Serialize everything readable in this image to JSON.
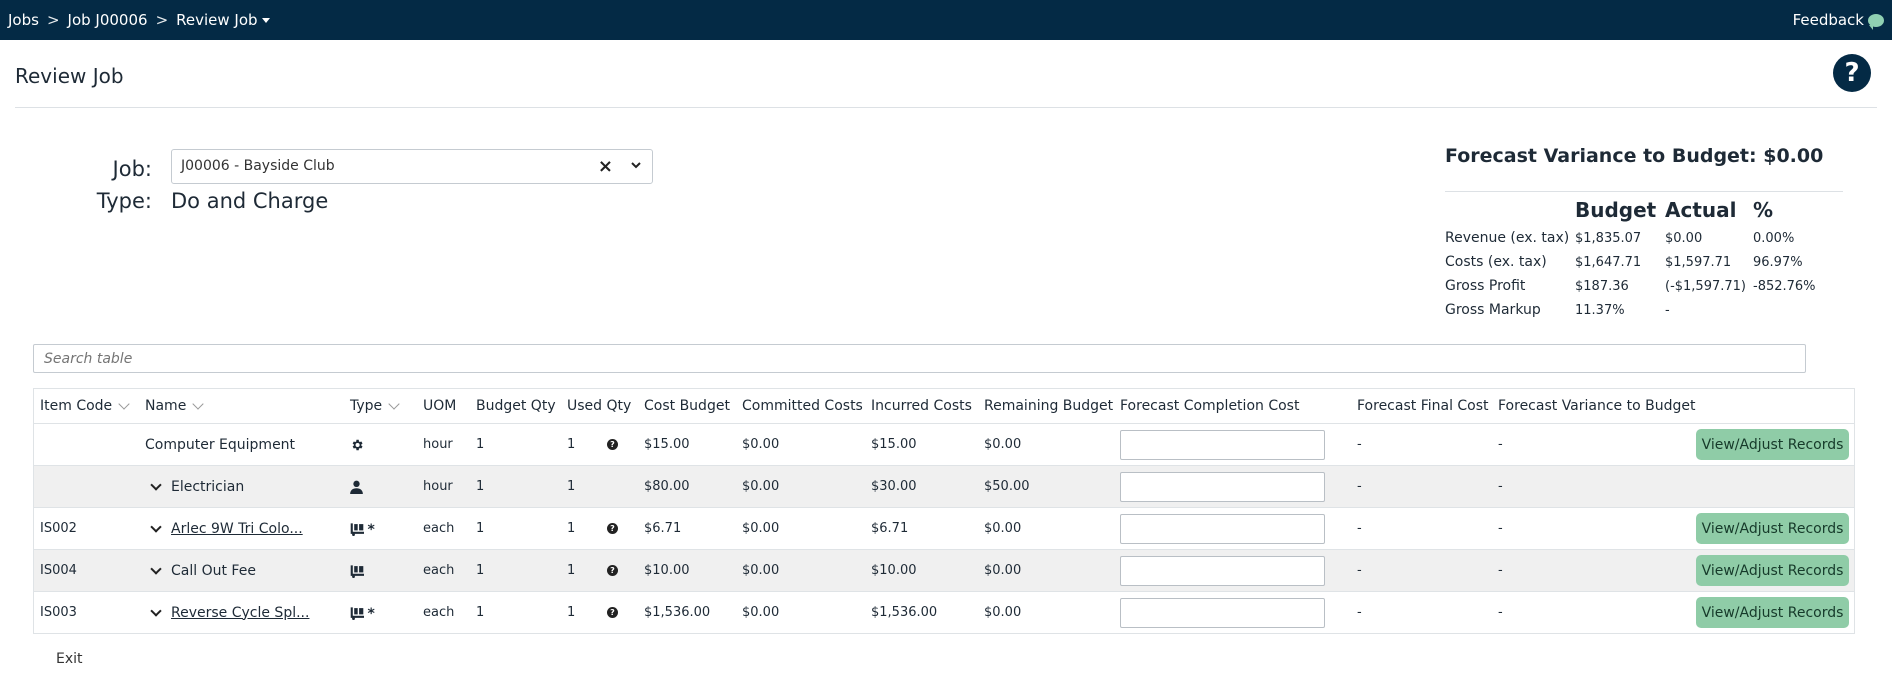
{
  "topbar": {
    "crumb_jobs": "Jobs",
    "crumb_sep": ">",
    "crumb_job": "Job J00006",
    "crumb_review": "Review Job",
    "feedback": "Feedback"
  },
  "page": {
    "title": "Review Job",
    "help": "?"
  },
  "form": {
    "job_label": "Job:",
    "job_value": "J00006 - Bayside Club",
    "type_label": "Type:",
    "type_value": "Do and Charge"
  },
  "summary": {
    "heading": "Forecast Variance to Budget: $0.00",
    "col_budget": "Budget",
    "col_actual": "Actual",
    "col_pct": "%",
    "rows": [
      {
        "label": "Revenue (ex. tax)",
        "budget": "$1,835.07",
        "actual": "$0.00",
        "pct": "0.00%"
      },
      {
        "label": "Costs (ex. tax)",
        "budget": "$1,647.71",
        "actual": "$1,597.71",
        "pct": "96.97%"
      },
      {
        "label": "Gross Profit",
        "budget": "$187.36",
        "actual": "(-$1,597.71)",
        "pct": "-852.76%"
      },
      {
        "label": "Gross Markup",
        "budget": "11.37%",
        "actual": "-",
        "pct": ""
      }
    ]
  },
  "search": {
    "placeholder": "Search table"
  },
  "table": {
    "headers": {
      "item_code": "Item Code",
      "name": "Name",
      "type": "Type",
      "uom": "UOM",
      "budget_qty": "Budget Qty",
      "used_qty": "Used Qty",
      "cost_budget": "Cost Budget",
      "committed": "Committed Costs",
      "incurred": "Incurred Costs",
      "remaining": "Remaining Budget",
      "fc_completion": "Forecast Completion Cost",
      "fc_final": "Forecast Final Cost",
      "fc_variance": "Forecast Variance to Budget"
    },
    "rows": [
      {
        "code": "",
        "name": "Computer Equipment",
        "type_icon": "gear-icon",
        "uom": "hour",
        "budget_qty": "1",
        "used_qty": "1",
        "cost_budget": "$15.00",
        "committed": "$0.00",
        "incurred": "$15.00",
        "remaining": "$0.00",
        "fc_final": "-",
        "fc_variance": "-",
        "button": "View/Adjust Records"
      },
      {
        "code": "",
        "name": "Electrician",
        "type_icon": "person-icon",
        "uom": "hour",
        "budget_qty": "1",
        "used_qty": "1",
        "cost_budget": "$80.00",
        "committed": "$0.00",
        "incurred": "$30.00",
        "remaining": "$50.00",
        "fc_final": "-",
        "fc_variance": "-",
        "button": ""
      },
      {
        "code": "IS002",
        "name": "Arlec 9W Tri Colo...",
        "type_icon": "stock-item-icon",
        "uom": "each",
        "budget_qty": "1",
        "used_qty": "1",
        "cost_budget": "$6.71",
        "committed": "$0.00",
        "incurred": "$6.71",
        "remaining": "$0.00",
        "fc_final": "-",
        "fc_variance": "-",
        "button": "View/Adjust Records"
      },
      {
        "code": "IS004",
        "name": "Call Out Fee",
        "type_icon": "stock-item-icon",
        "uom": "each",
        "budget_qty": "1",
        "used_qty": "1",
        "cost_budget": "$10.00",
        "committed": "$0.00",
        "incurred": "$10.00",
        "remaining": "$0.00",
        "fc_final": "-",
        "fc_variance": "-",
        "button": "View/Adjust Records"
      },
      {
        "code": "IS003",
        "name": "Reverse Cycle Spl...",
        "type_icon": "stock-item-icon",
        "uom": "each",
        "budget_qty": "1",
        "used_qty": "1",
        "cost_budget": "$1,536.00",
        "committed": "$0.00",
        "incurred": "$1,536.00",
        "remaining": "$0.00",
        "fc_final": "-",
        "fc_variance": "-",
        "button": "View/Adjust Records"
      }
    ]
  },
  "footer": {
    "exit": "Exit"
  }
}
